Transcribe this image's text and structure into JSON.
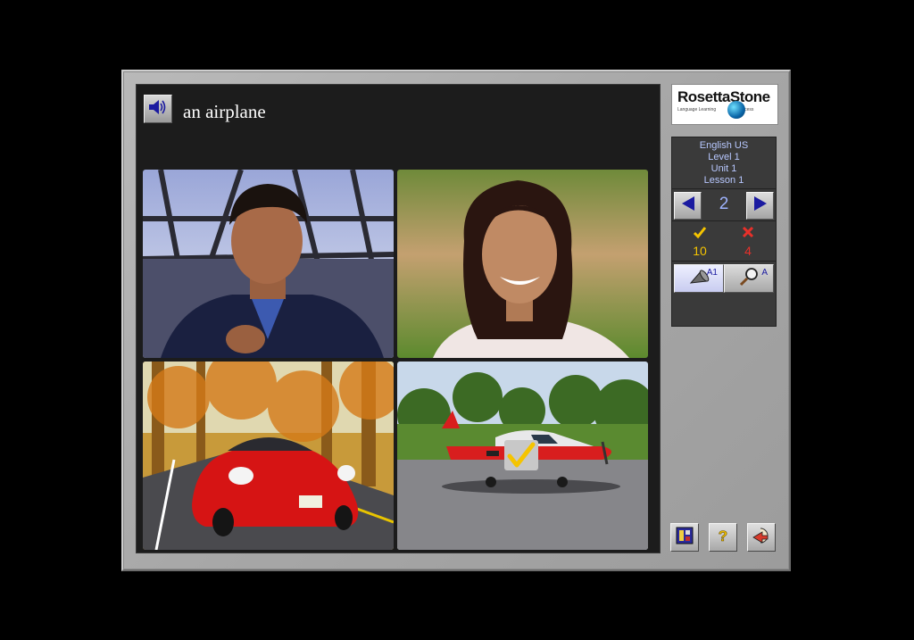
{
  "prompt": {
    "text": "an airplane",
    "speaker_icon": "speaker-icon"
  },
  "tiles": [
    {
      "name": "man-photo",
      "description_icon": "photo-man"
    },
    {
      "name": "woman-photo",
      "description_icon": "photo-woman"
    },
    {
      "name": "car-photo",
      "description_icon": "photo-car"
    },
    {
      "name": "airplane-photo",
      "description_icon": "photo-airplane",
      "selected": true
    }
  ],
  "logo": {
    "brand_left": "Rosetta",
    "brand_right": "Stone",
    "tagline_left": "Language Learning",
    "tagline_right": "Success"
  },
  "course": {
    "language": "English US",
    "level": "Level 1",
    "unit": "Unit 1",
    "lesson": "Lesson 1"
  },
  "navigation": {
    "page": "2",
    "prev_icon": "left-arrow-icon",
    "next_icon": "right-arrow-icon"
  },
  "score": {
    "correct": "10",
    "incorrect": "4",
    "correct_icon": "checkmark-icon",
    "incorrect_icon": "x-mark-icon"
  },
  "modes": {
    "speak_tag": "A1",
    "lookup_tag": "A"
  },
  "colors": {
    "accent_blue": "#1a1aa0",
    "correct": "#f5c400",
    "incorrect": "#e8302a",
    "frame": "#aaaaaa"
  }
}
